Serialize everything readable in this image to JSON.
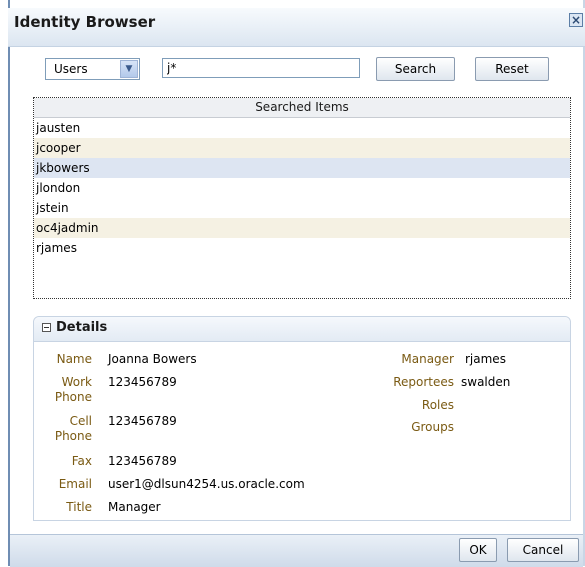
{
  "dialog": {
    "title": "Identity Browser",
    "close_label": "×"
  },
  "search": {
    "type_selected": "Users",
    "query": "j*",
    "search_label": "Search",
    "reset_label": "Reset"
  },
  "results": {
    "header": "Searched Items",
    "items": [
      "jausten",
      "jcooper",
      "jkbowers",
      "jlondon",
      "jstein",
      "oc4jadmin",
      "rjames"
    ],
    "selected_index": 2
  },
  "details": {
    "title": "Details",
    "name_label": "Name",
    "name": "Joanna Bowers",
    "work_phone_label_1": "Work",
    "work_phone_label_2": "Phone",
    "work_phone": "123456789",
    "cell_phone_label_1": "Cell",
    "cell_phone_label_2": "Phone",
    "cell_phone": "123456789",
    "fax_label": "Fax",
    "fax": "123456789",
    "email_label": "Email",
    "email": "user1@dlsun4254.us.oracle.com",
    "title_label": "Title",
    "title_value": "Manager",
    "manager_label": "Manager",
    "manager": "rjames",
    "reportees_label": "Reportees",
    "reportees": "swalden",
    "roles_label": "Roles",
    "roles": "",
    "groups_label": "Groups",
    "groups": ""
  },
  "footer": {
    "ok_label": "OK",
    "cancel_label": "Cancel"
  }
}
